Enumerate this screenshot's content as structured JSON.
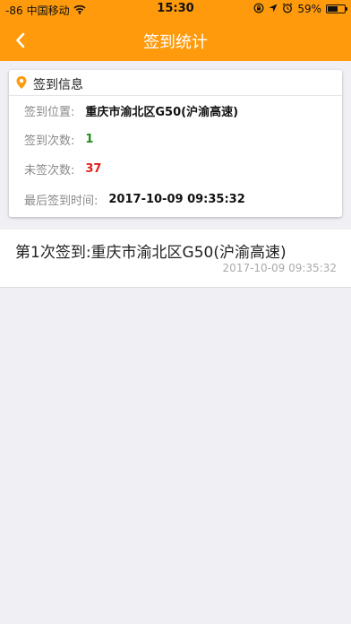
{
  "status_bar": {
    "signal": "-86",
    "carrier": "中国移动",
    "time": "15:30",
    "battery": "59%",
    "battery_level": 0.59,
    "icons": [
      "wifi-icon",
      "screen-lock-icon",
      "location-icon",
      "alarm-icon",
      "battery-icon"
    ]
  },
  "navbar": {
    "title": "签到统计",
    "back_icon": "chevron-left-icon"
  },
  "info_card": {
    "title": "签到信息",
    "icon": "location-pin-icon",
    "location_label": "签到位置:",
    "location_value": "重庆市渝北区G50(沪渝高速)",
    "checkin_count_label": "签到次数:",
    "checkin_count_value": "1",
    "missed_count_label": "未签次数:",
    "missed_count_value": "37",
    "last_time_label": "最后签到时间:",
    "last_time_value": "2017-10-09 09:35:32"
  },
  "records": [
    {
      "title": "第1次签到:重庆市渝北区G50(沪渝高速)",
      "time": "2017-10-09 09:35:32"
    }
  ],
  "colors": {
    "accent": "#fe9a0b",
    "background": "#efeff4",
    "count_green": "#1a8c1a",
    "count_red": "#e02020"
  }
}
